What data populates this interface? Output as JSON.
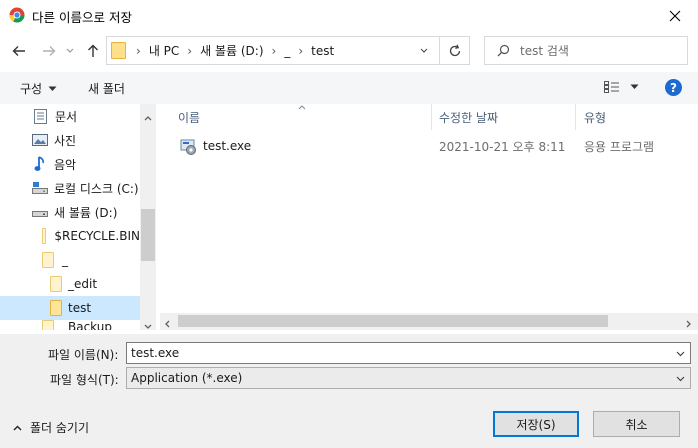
{
  "window": {
    "title": "다른 이름으로 저장"
  },
  "address": {
    "path": [
      "내 PC",
      "새 볼륨 (D:)",
      "_",
      "test"
    ],
    "search_placeholder": "test 검색"
  },
  "toolbar": {
    "organize_label": "구성",
    "new_folder_label": "새 폴더"
  },
  "nav": {
    "items": [
      {
        "label": "문서",
        "icon": "documents-icon"
      },
      {
        "label": "사진",
        "icon": "pictures-icon"
      },
      {
        "label": "음악",
        "icon": "music-icon"
      },
      {
        "label": "로컬 디스크 (C:)",
        "icon": "drive-icon"
      },
      {
        "label": "새 볼륨 (D:)",
        "icon": "drive-icon"
      },
      {
        "label": "$RECYCLE.BIN",
        "icon": "folder-icon"
      },
      {
        "label": "_",
        "icon": "folder-icon"
      },
      {
        "label": "_edit",
        "icon": "folder-icon"
      },
      {
        "label": "test",
        "icon": "folder-icon",
        "selected": true
      },
      {
        "label": "_Backup",
        "icon": "folder-icon"
      }
    ]
  },
  "columns": {
    "name": "이름",
    "date": "수정한 날짜",
    "type": "유형"
  },
  "files": [
    {
      "name": "test.exe",
      "date": "2021-10-21 오후 8:11",
      "type": "응용 프로그램"
    }
  ],
  "form": {
    "filename_label": "파일 이름(N):",
    "filename_value": "test.exe",
    "filetype_label": "파일 형식(T):",
    "filetype_value": "Application (*.exe)",
    "hide_folders_label": "폴더 숨기기",
    "save_label": "저장(S)",
    "cancel_label": "취소"
  },
  "colors": {
    "accent": "#0078d7",
    "selection": "#cce8ff"
  }
}
